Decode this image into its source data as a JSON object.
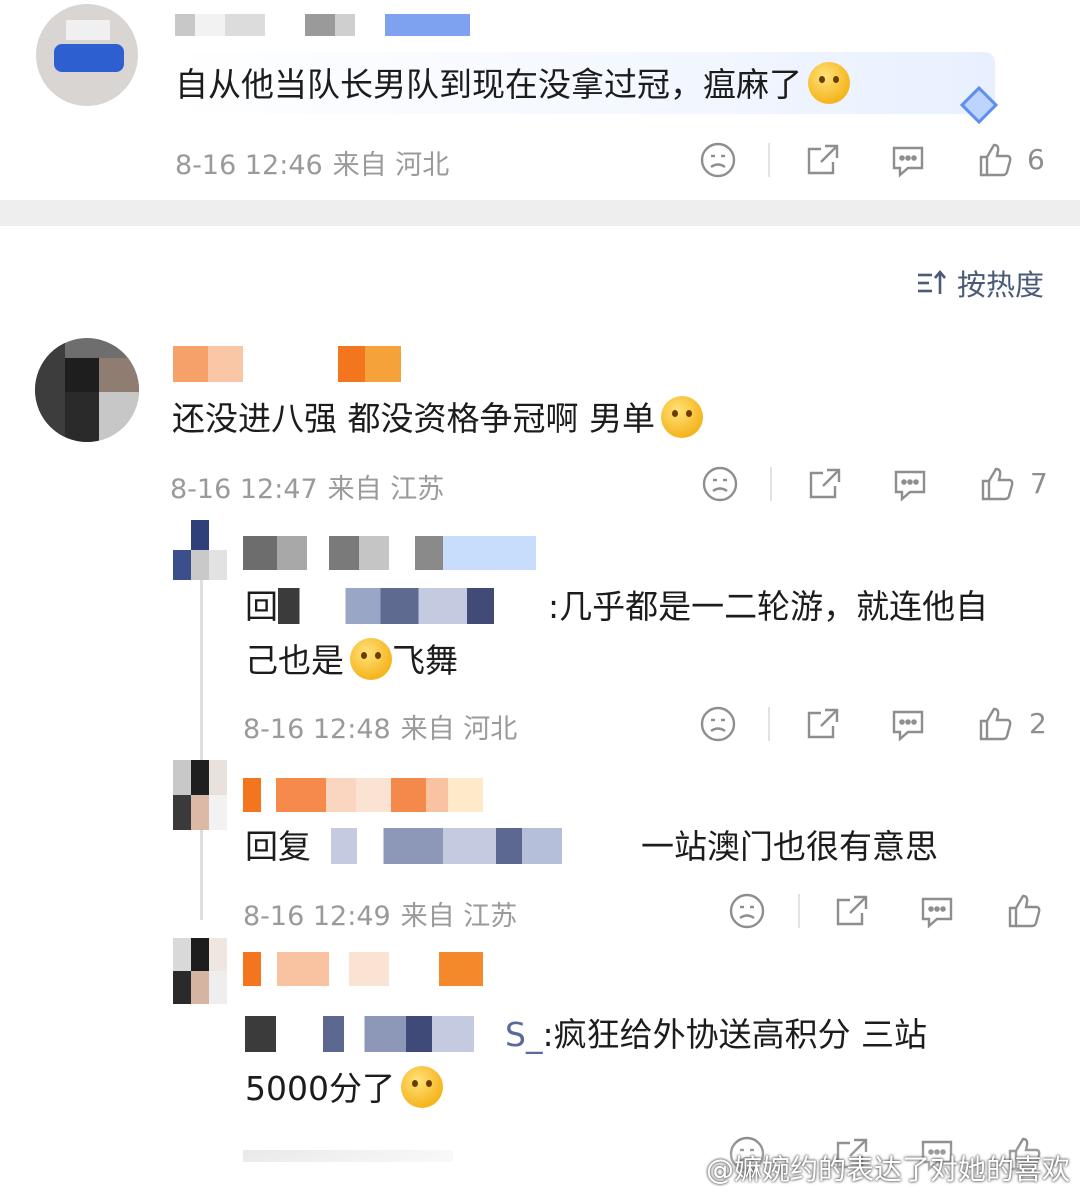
{
  "comments": [
    {
      "text": "自从他当队长男队到现在没拿过冠，瘟麻了",
      "date": "8-16 12:46",
      "location": "来自 河北",
      "likes": "6"
    },
    {
      "text": "还没进八强 都没资格争冠啊 男单",
      "date": "8-16 12:47",
      "location": "来自 江苏",
      "likes": "7"
    }
  ],
  "sort_label": "按热度",
  "replies": [
    {
      "prefix": "回",
      "text_line1": ":几乎都是一二轮游，就连他自",
      "text_line2": "己也是",
      "text_line2_suffix": "飞舞",
      "date": "8-16 12:48",
      "location": "来自 河北",
      "likes": "2"
    },
    {
      "prefix": "回复",
      "text_line1": "一站澳门也很有意思",
      "date": "8-16 12:49",
      "location": "来自 江苏",
      "likes": ""
    },
    {
      "prefix_tail": "S_",
      "text_line1": ":疯狂给外协送高积分 三站",
      "text_line2": "5000分了"
    }
  ],
  "watermark": "@嫲婉约的表达了对她的喜欢",
  "icons": [
    "dislike-face-icon",
    "share-icon",
    "comment-icon",
    "thumbs-up-icon",
    "sort-icon"
  ],
  "colors": {
    "meta": "#9a9a9a",
    "sort": "#4a5a78",
    "band": "#eeeeee"
  }
}
